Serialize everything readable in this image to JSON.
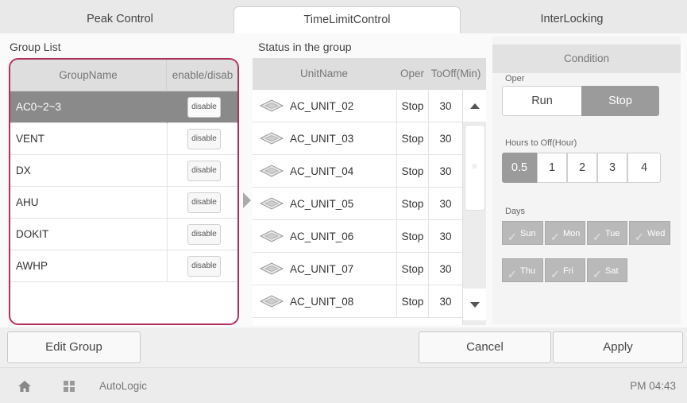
{
  "tabs": [
    {
      "label": "Peak Control"
    },
    {
      "label": "TimeLimitControl"
    },
    {
      "label": "InterLocking"
    }
  ],
  "group_list": {
    "title": "Group List",
    "columns": {
      "name": "GroupName",
      "enable": "enable/disab"
    },
    "rows": [
      {
        "name": "AC0~2~3",
        "button": "disable"
      },
      {
        "name": "VENT",
        "button": "disable"
      },
      {
        "name": "DX",
        "button": "disable"
      },
      {
        "name": "AHU",
        "button": "disable"
      },
      {
        "name": "DOKIT",
        "button": "disable"
      },
      {
        "name": "AWHP",
        "button": "disable"
      }
    ],
    "selected_index": 0
  },
  "status": {
    "title": "Status in the group",
    "columns": {
      "unit": "UnitName",
      "oper": "Oper",
      "tooff": "ToOff(Min)"
    },
    "rows": [
      {
        "unit": "AC_UNIT_02",
        "oper": "Stop",
        "tooff": "30"
      },
      {
        "unit": "AC_UNIT_03",
        "oper": "Stop",
        "tooff": "30"
      },
      {
        "unit": "AC_UNIT_04",
        "oper": "Stop",
        "tooff": "30"
      },
      {
        "unit": "AC_UNIT_05",
        "oper": "Stop",
        "tooff": "30"
      },
      {
        "unit": "AC_UNIT_06",
        "oper": "Stop",
        "tooff": "30"
      },
      {
        "unit": "AC_UNIT_07",
        "oper": "Stop",
        "tooff": "30"
      },
      {
        "unit": "AC_UNIT_08",
        "oper": "Stop",
        "tooff": "30"
      }
    ]
  },
  "condition": {
    "title": "Condition",
    "oper_label": "Oper",
    "oper_options": [
      "Run",
      "Stop"
    ],
    "oper_selected": "Stop",
    "hours_label": "Hours to Off(Hour)",
    "hours_options": [
      "0.5",
      "1",
      "2",
      "3",
      "4"
    ],
    "hours_selected": "0.5",
    "days_label": "Days",
    "days": [
      "Sun",
      "Mon",
      "Tue",
      "Wed",
      "Thu",
      "Fri",
      "Sat"
    ]
  },
  "buttons": {
    "edit_group": "Edit Group",
    "cancel": "Cancel",
    "apply": "Apply"
  },
  "footer": {
    "app_name": "AutoLogic",
    "time": "PM 04:43"
  },
  "icons": {
    "home": "home-icon",
    "grid": "grid-icon",
    "unit": "cassette-unit-icon",
    "check": "check-icon"
  },
  "colors": {
    "selection": "#8a8a8a",
    "highlight_border": "#b0305c",
    "active_segment": "#9b9b9b"
  }
}
